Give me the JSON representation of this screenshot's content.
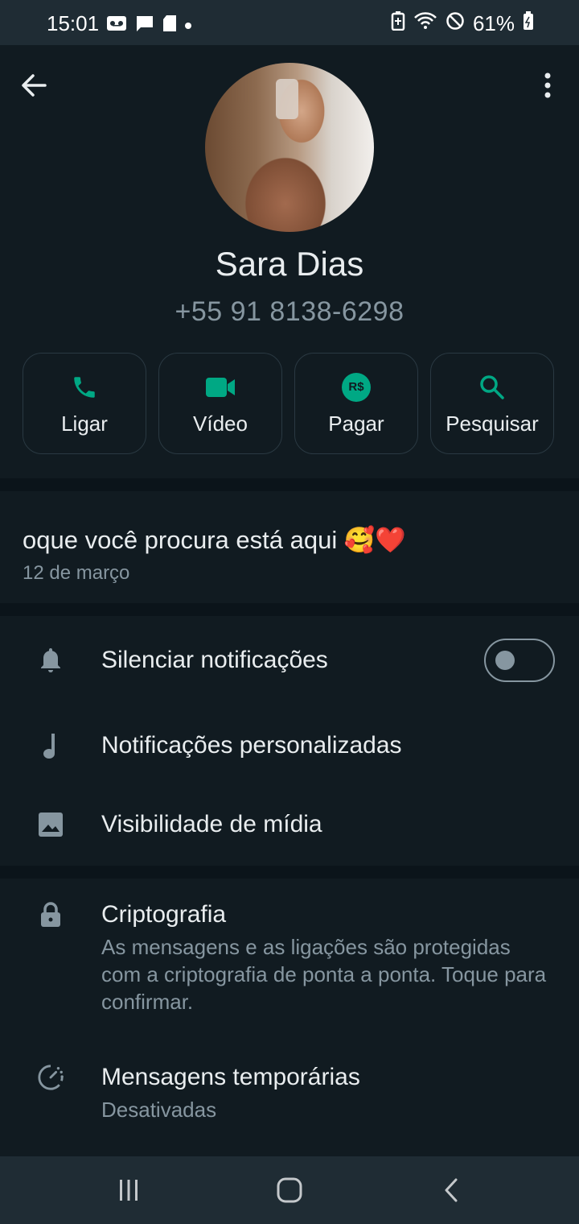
{
  "status_bar": {
    "time": "15:01",
    "battery": "61%",
    "left_icons": [
      "voicemail-icon",
      "message-icon",
      "sd-card-icon",
      "dot-icon"
    ],
    "right_icons": [
      "battery-saver-icon",
      "wifi-icon",
      "do-not-disturb-icon",
      "battery-icon"
    ]
  },
  "contact": {
    "name": "Sara Dias",
    "phone": "+55 91 8138-6298"
  },
  "actions": [
    {
      "label": "Ligar",
      "icon": "phone-icon"
    },
    {
      "label": "Vídeo",
      "icon": "video-icon"
    },
    {
      "label": "Pagar",
      "icon": "pay-icon",
      "badge": "R$"
    },
    {
      "label": "Pesquisar",
      "icon": "search-icon"
    }
  ],
  "about": {
    "text": "oque você procura está aqui 🥰❤️",
    "date": "12 de março"
  },
  "settings": {
    "mute": {
      "label": "Silenciar notificações",
      "enabled": false
    },
    "custom_notifications": {
      "label": "Notificações personalizadas"
    },
    "media_visibility": {
      "label": "Visibilidade de mídia"
    }
  },
  "security": {
    "encryption": {
      "label": "Criptografia",
      "description": "As mensagens e as ligações são protegidas com a criptografia de ponta a ponta. Toque para confirmar."
    },
    "disappearing": {
      "label": "Mensagens temporárias",
      "value": "Desativadas"
    }
  },
  "colors": {
    "accent": "#00a884",
    "background": "#111b21",
    "divider": "#0b141a",
    "secondary_text": "#8696a0"
  }
}
